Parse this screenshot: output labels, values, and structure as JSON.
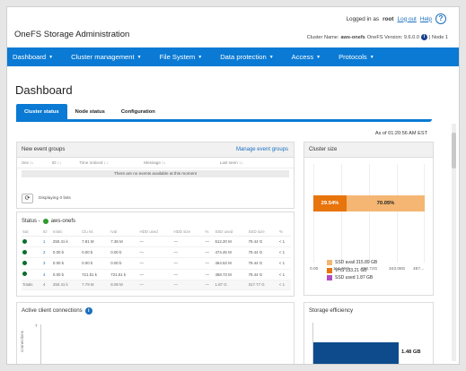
{
  "header": {
    "logged_in_prefix": "Logged in as",
    "user": "root",
    "logout_label": "Log out",
    "help_label": "Help",
    "help_icon": "?",
    "app_title": "OneFS Storage Administration",
    "cluster_name_label": "Cluster Name:",
    "cluster_name": "aws-onefs",
    "onefs_version": "OneFS Version: 9.6.0.0",
    "node": "| Node 1"
  },
  "nav": {
    "items": [
      {
        "label": "Dashboard"
      },
      {
        "label": "Cluster management"
      },
      {
        "label": "File System"
      },
      {
        "label": "Data protection"
      },
      {
        "label": "Access"
      },
      {
        "label": "Protocols"
      }
    ],
    "caret": "▼"
  },
  "page": {
    "title": "Dashboard",
    "tabs": [
      "Cluster status",
      "Node status",
      "Configuration"
    ],
    "as_of": "As of 01:20:56 AM EST"
  },
  "events": {
    "title": "New event groups",
    "manage_link": "Manage event groups",
    "columns": [
      "Sev ↕↓",
      "ID ↕↓",
      "Time noticed ↕↓",
      "Message ↕↓",
      "Last seen ↕↓"
    ],
    "empty_message": "There are no events available at this moment",
    "displaying": "Displaying 0 lists",
    "refresh_icon": "⟳"
  },
  "status": {
    "label": "Status -",
    "cluster": "aws-onefs",
    "columns": [
      "Sat",
      "ID",
      "In/atc",
      "Clu Ist",
      "Ival",
      "HDD used",
      "HDD size",
      "%",
      "SSD used",
      "SSD size",
      "%"
    ],
    "rows": [
      {
        "id": "1",
        "c1": "250.41 k",
        "c2": "7.81 M",
        "c3": "7.36 M",
        "c4": "—",
        "c5": "—",
        "c6": "—",
        "c7": "512.20 M",
        "c8": "79.44 G",
        "c9": "< 1"
      },
      {
        "id": "2",
        "c1": "0.00 b",
        "c2": "0.00 b",
        "c3": "0.00 b",
        "c4": "—",
        "c5": "—",
        "c6": "—",
        "c7": "474.45 M",
        "c8": "79.44 G",
        "c9": "< 1"
      },
      {
        "id": "3",
        "c1": "0.00 b",
        "c2": "0.00 b",
        "c3": "0.00 b",
        "c4": "—",
        "c5": "—",
        "c6": "—",
        "c7": "464.53 M",
        "c8": "79.44 G",
        "c9": "< 1"
      },
      {
        "id": "4",
        "c1": "0.00 b",
        "c2": "721.51 k",
        "c3": "721.51 k",
        "c4": "—",
        "c5": "—",
        "c6": "—",
        "c7": "458.73 M",
        "c8": "79.44 G",
        "c9": "< 1"
      }
    ],
    "total": {
      "label": "Totals",
      "id": "4",
      "c1": "250.41 k",
      "c2": "7.79 M",
      "c3": "8.08 M",
      "c4": "—",
      "c5": "—",
      "c6": "—",
      "c7": "1.87 G",
      "c8": "317.77 G",
      "c9": "< 1"
    }
  },
  "clients": {
    "title": "Active client connections",
    "info_icon": "i",
    "y_tick": "7",
    "y_label": "connections"
  },
  "cluster_size": {
    "title": "Cluster size",
    "seg1_label": "29.54%",
    "seg2_label": "70.05%",
    "x_ticks": [
      "0.00",
      "114.36G",
      "228.72G",
      "343.08G",
      "457..."
    ],
    "legend": [
      {
        "label": "SSD avail 315.89 GB",
        "color": "#f5b673"
      },
      {
        "label": "VHS 133.21 GB",
        "color": "#e8740c"
      },
      {
        "label": "SSD used 1.87 GB",
        "color": "#b04fbf"
      }
    ]
  },
  "storage_eff": {
    "title": "Storage efficiency",
    "value_label": "1.48 GB"
  },
  "chart_data": [
    {
      "type": "bar",
      "title": "Cluster size",
      "orientation": "horizontal-stacked",
      "x_ticks": [
        "0.00",
        "114.36G",
        "228.72G",
        "343.08G",
        "457..."
      ],
      "series": [
        {
          "name": "VHS 133.21 GB",
          "values": [
            29.54
          ],
          "color": "#e8740c"
        },
        {
          "name": "SSD avail 315.89 GB",
          "values": [
            70.05
          ],
          "color": "#f5b673"
        },
        {
          "name": "SSD used 1.87 GB",
          "values": [
            0.41
          ],
          "color": "#b04fbf"
        }
      ]
    },
    {
      "type": "bar",
      "title": "Storage efficiency",
      "values": [
        1.48
      ],
      "unit": "GB",
      "color": "#0e4b8d"
    }
  ]
}
